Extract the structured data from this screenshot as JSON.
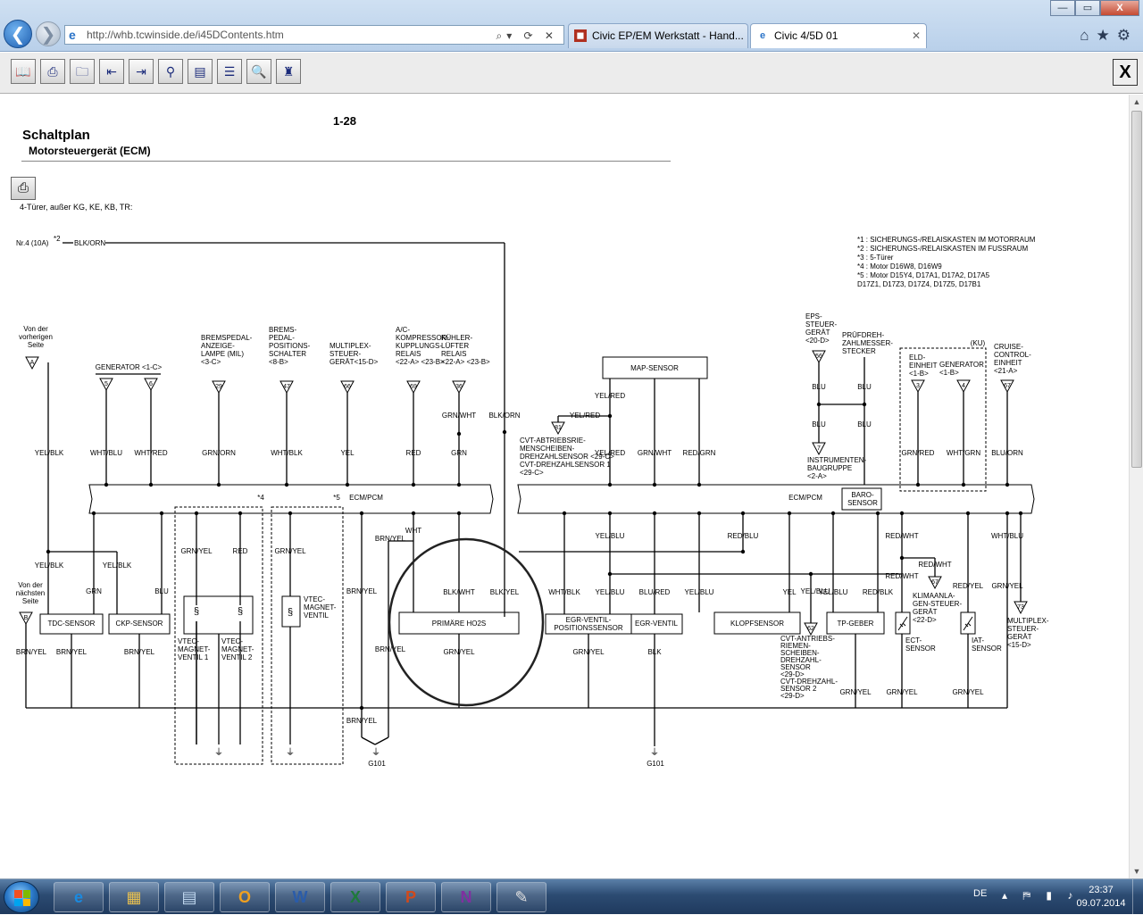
{
  "browser": {
    "url": "http://whb.tcwinside.de/i45DContents.htm",
    "address_actions": "⌕▾ ⟳ ✕",
    "tabs": [
      {
        "label": "Civic EP/EM Werkstatt - Hand..."
      },
      {
        "label": "Civic 4/5D 01",
        "close": "✕"
      }
    ],
    "window_buttons": {
      "minimize": "—",
      "maximize": "▭",
      "close": "X"
    },
    "toolbar_right_icons": "⌂★⚙",
    "toolbar_buttons": [
      {
        "icon": "book-icon",
        "glyph": "📖"
      },
      {
        "icon": "print-icon",
        "glyph": "⎙"
      },
      {
        "icon": "folder-up-icon",
        "glyph": "🗀"
      },
      {
        "icon": "page-back-icon",
        "glyph": "⇤"
      },
      {
        "icon": "page-forward-icon",
        "glyph": "⇥"
      },
      {
        "icon": "binoculars-icon",
        "glyph": "⚲"
      },
      {
        "icon": "page-view-icon",
        "glyph": "▤"
      },
      {
        "icon": "stack-icon",
        "glyph": "☰"
      },
      {
        "icon": "preview-icon",
        "glyph": "🔍"
      },
      {
        "icon": "figure-icon",
        "glyph": "♜"
      }
    ],
    "close_doc_label": "X"
  },
  "document": {
    "page_number": "1-28",
    "title": "Schaltplan",
    "subtitle": "Motorsteuergerät (ECM)",
    "print_glyph": "⎙",
    "note": "4-Türer, außer KG, KE, KB, TR:"
  },
  "diagram": {
    "power_feed": "Nr.4 (10A)",
    "power_feed_ref": "*2",
    "power_wire": "BLK/ORN",
    "footnotes": [
      "*1 :  SICHERUNGS-/RELAISKASTEN IM MOTORRAUM",
      "*2 :  SICHERUNGS-/RELAISKASTEN IM FUSSRAUM",
      "*3 :  5-Türer",
      "*4 :  Motor D16W8, D16W9",
      "*5 :  Motor D15Y4, D17A1, D17A2, D17A5",
      "        D17Z1, D17Z3, D17Z4, D17Z5, D17B1"
    ],
    "ecm_label_left": "ECM/PCM",
    "ecm_label_right": "ECM/PCM",
    "ecm_ref4": "*4",
    "ecm_ref5": "*5",
    "baro_sensor": [
      "BARO-",
      "SENSOR"
    ],
    "from_prev": [
      "Von der",
      "vorherigen",
      "Seite"
    ],
    "from_prev_conn": "A",
    "from_next": [
      "Von der",
      "nächsten",
      "Seite"
    ],
    "from_next_conn": "B",
    "top_components": [
      {
        "lines": [
          "GENERATOR <1-C>"
        ],
        "conn": [
          "5",
          "6"
        ]
      },
      {
        "lines": [
          "BREMSPEDAL-",
          "ANZEIGE-",
          "LAMPE (MIL)",
          "<3-C>"
        ],
        "conn": [
          "29"
        ]
      },
      {
        "lines": [
          "BREMS-",
          "PEDAL-",
          "POSITIONS-",
          "SCHALTER",
          "<8-B>"
        ],
        "conn": [
          "47"
        ]
      },
      {
        "lines": [
          "MULTIPLEX-",
          "STEUER-",
          "GERÄT<15-D>"
        ],
        "conn": [
          "66"
        ]
      },
      {
        "lines": [
          "A/C-",
          "KOMPRESSOR-",
          "KUPPLUNGS-",
          "RELAIS",
          "<22-A> <23-B>"
        ],
        "conn": [
          "69"
        ]
      },
      {
        "lines": [
          "KÜHLER-",
          "LÜFTER",
          "RELAIS",
          "<22-A> <23-B>"
        ],
        "conn": [
          "36"
        ]
      },
      {
        "lines": [
          "MAP-SENSOR"
        ],
        "conn": []
      },
      {
        "lines": [
          "EPS-",
          "STEUER-",
          "GERÄT",
          "<20-D>"
        ],
        "conn": [
          "56"
        ]
      },
      {
        "lines": [
          "PRÜFDREH-",
          "ZAHLMESSER-",
          "STECKER"
        ],
        "conn": []
      },
      {
        "lines": [
          "ELD-",
          "EINHEIT",
          "<1-B>"
        ],
        "conn": [
          "3"
        ]
      },
      {
        "lines": [
          "GENERATOR",
          "<1-B>"
        ],
        "conn": [
          "4"
        ]
      },
      {
        "lines": [
          "(KU)"
        ],
        "conn": []
      },
      {
        "lines": [
          "CRUISE-",
          "CONTROL-",
          "EINHEIT",
          "<21-A>"
        ],
        "conn": [
          "67"
        ]
      }
    ],
    "cvt_notes_top": [
      "CVT-ABTRIEBSRIE-",
      "MENSCHEIBEN-",
      "DREHZAHLSENSOR <29-C>",
      "CVT-DREHZAHLSENSOR 1",
      "<29-C>"
    ],
    "cvt_conn_top": "81",
    "instrument": [
      "INSTRUMENTEN-",
      "BAUGRUPPE",
      "<2-A>"
    ],
    "instrument_conn": "7",
    "wires_top": [
      "YEL/BLK",
      "WHT/BLU",
      "WHT/RED",
      "GRN/ORN",
      "WHT/BLK",
      "YEL",
      "RED",
      "GRN",
      "GRN/WHT",
      "BLK/ORN",
      "YEL/RED",
      "YEL/RED",
      "YEL/RED",
      "GRN/WHT",
      "RED/GRN",
      "BLU",
      "BLU",
      "BLU",
      "BLU",
      "GRN/RED",
      "WHT/GRN",
      "BLU/ORN"
    ],
    "wires_bottom": [
      "YEL/BLK",
      "YEL/BLK",
      "GRN",
      "BLU",
      "GRN/YEL",
      "RED",
      "GRN/YEL",
      "BRN/YEL",
      "WHT",
      "BLK/WHT",
      "BLK/YEL",
      "GRN/YEL",
      "YEL/BLU",
      "RED/BLU",
      "WHT/BLK",
      "YEL/BLU",
      "BLU/RED",
      "YEL/BLU",
      "YEL",
      "YEL/BLU",
      "RED/BLK",
      "RED/WHT",
      "RED/WHT",
      "RED/WHT",
      "RED/YEL",
      "GRN/YEL",
      "WHT/BLU",
      "BRN/YEL",
      "BRN/YEL",
      "BRN/YEL",
      "BRN/YEL",
      "BRN/YEL",
      "GRN/YEL",
      "GRN/YEL",
      "BLK",
      "GRN/YEL",
      "GRN/YEL",
      "GRN/YEL",
      "BRN/YEL"
    ],
    "bottom_components": [
      {
        "label": [
          "TDC-SENSOR"
        ]
      },
      {
        "label": [
          "CKP-SENSOR"
        ]
      },
      {
        "label": [
          "VTEC-",
          "MAGNET-",
          "VENTIL 1"
        ]
      },
      {
        "label": [
          "VTEC-",
          "MAGNET-",
          "VENTIL 2"
        ]
      },
      {
        "label": [
          "VTEC-",
          "MAGNET-",
          "VENTIL"
        ]
      },
      {
        "label": [
          "PRIMÄRE HO2S"
        ]
      },
      {
        "label": [
          "EGR-VENTIL-",
          "POSITIONSSENSOR"
        ]
      },
      {
        "label": [
          "EGR-VENTIL"
        ]
      },
      {
        "label": [
          "KLOPFSENSOR"
        ]
      },
      {
        "label": [
          "TP-GEBER"
        ]
      },
      {
        "label": [
          "ECT-",
          "SENSOR"
        ]
      },
      {
        "label": [
          "IAT-",
          "SENSOR"
        ]
      },
      {
        "label": [
          "KLIMAANLA-",
          "GEN-STEUER-",
          "GERÄT",
          "<22-D>"
        ]
      },
      {
        "label": [
          "MULTIPLEX-",
          "STEUER-",
          "GERÄT",
          "<15-D>"
        ]
      }
    ],
    "cvt_notes_bottom": [
      "CVT-ANTRIEBS-",
      "RIEMEN-",
      "SCHEIBEN-",
      "DREHZAHL-",
      "SENSOR",
      "<29-D>",
      "CVT-DREHZAHL-",
      "SENSOR 2",
      "<29-D>"
    ],
    "cvt_conn_bottom": "62",
    "klima_conn": "67",
    "multiplex_conn": "73",
    "grounds": [
      "G101",
      "G101"
    ]
  },
  "taskbar": {
    "apps": [
      {
        "icon": "internet-explorer-icon",
        "glyph": "e",
        "color": "#1a8ae0"
      },
      {
        "icon": "file-explorer-icon",
        "glyph": "▦",
        "color": "#e8c050"
      },
      {
        "icon": "calculator-icon",
        "glyph": "▤",
        "color": "#c0d8f0"
      },
      {
        "icon": "outlook-icon",
        "glyph": "O",
        "color": "#f0a020"
      },
      {
        "icon": "word-icon",
        "glyph": "W",
        "color": "#2a5caa"
      },
      {
        "icon": "excel-icon",
        "glyph": "X",
        "color": "#1e7a3a"
      },
      {
        "icon": "powerpoint-icon",
        "glyph": "P",
        "color": "#d04a1c"
      },
      {
        "icon": "onenote-icon",
        "glyph": "N",
        "color": "#8030a0"
      },
      {
        "icon": "paint-icon",
        "glyph": "✎",
        "color": "#e0e0e0"
      }
    ],
    "language": "DE",
    "tray_icons": "▴ ⛿ ▮ ♪",
    "time": "23:37",
    "date": "09.07.2014"
  }
}
